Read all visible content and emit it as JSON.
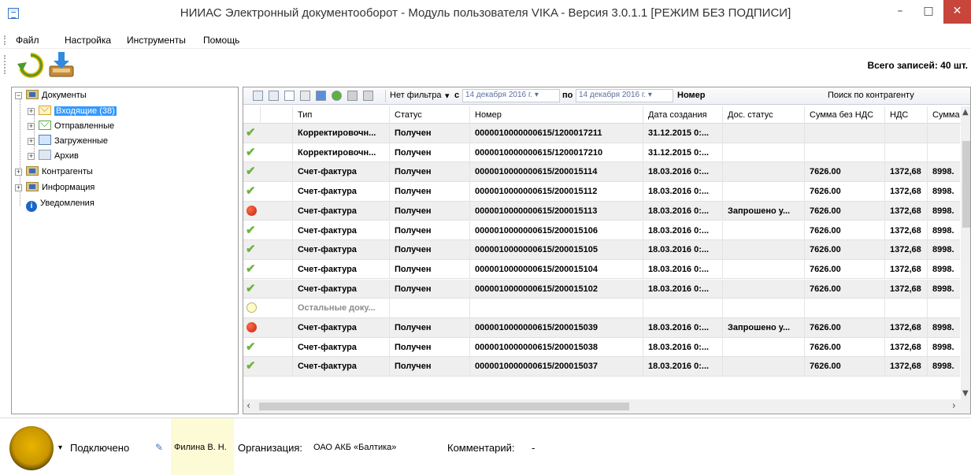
{
  "window": {
    "title": "НИИАС Электронный документооборот - Модуль пользователя VIKA - Версия 3.0.1.1 [РЕЖИМ БЕЗ ПОДПИСИ]",
    "minimize": "–",
    "maximize": "□",
    "close": "✕"
  },
  "menu": [
    "Файл",
    "Настройка",
    "Инструменты",
    "Помощь"
  ],
  "toolbar": {
    "total": "Всего записей: 40 шт."
  },
  "tree": {
    "documents": "Документы",
    "incoming": "Входящие (38)",
    "sent": "Отправленные",
    "uploaded": "Загруженные",
    "archive": "Архив",
    "contractors": "Контрагенты",
    "information": "Информация",
    "notifications": "Уведомления"
  },
  "grid_toolbar": {
    "filter": "Нет фильтра",
    "from_label": "с",
    "from_date": "14 декабря  2016 г.",
    "to_label": "по",
    "to_date": "14 декабря  2016 г.",
    "number_label": "Номер",
    "search_label": "Поиск по контрагенту"
  },
  "columns": [
    "Тип",
    "Статус",
    "Номер",
    "Дата создания",
    "Дос. статус",
    "Сумма без НДС",
    "НДС",
    "Сумма"
  ],
  "rows": [
    {
      "icon": "check",
      "type": "Корректировочн...",
      "status": "Получен",
      "number": "0000010000000615/1200017211",
      "date": "31.12.2015 0:...",
      "doc_status": "",
      "sum": "",
      "vat": "",
      "total": ""
    },
    {
      "icon": "check",
      "type": "Корректировочн...",
      "status": "Получен",
      "number": "0000010000000615/1200017210",
      "date": "31.12.2015 0:...",
      "doc_status": "",
      "sum": "",
      "vat": "",
      "total": ""
    },
    {
      "icon": "check",
      "type": "Счет-фактура",
      "status": "Получен",
      "number": "0000010000000615/200015114",
      "date": "18.03.2016 0:...",
      "doc_status": "",
      "sum": "7626.00",
      "vat": "1372,68",
      "total": "8998."
    },
    {
      "icon": "check",
      "type": "Счет-фактура",
      "status": "Получен",
      "number": "0000010000000615/200015112",
      "date": "18.03.2016 0:...",
      "doc_status": "",
      "sum": "7626.00",
      "vat": "1372,68",
      "total": "8998."
    },
    {
      "icon": "red",
      "type": "Счет-фактура",
      "status": "Получен",
      "number": "0000010000000615/200015113",
      "date": "18.03.2016 0:...",
      "doc_status": "Запрошено у...",
      "sum": "7626.00",
      "vat": "1372,68",
      "total": "8998."
    },
    {
      "icon": "check",
      "type": "Счет-фактура",
      "status": "Получен",
      "number": "0000010000000615/200015106",
      "date": "18.03.2016 0:...",
      "doc_status": "",
      "sum": "7626.00",
      "vat": "1372,68",
      "total": "8998."
    },
    {
      "icon": "check",
      "type": "Счет-фактура",
      "status": "Получен",
      "number": "0000010000000615/200015105",
      "date": "18.03.2016 0:...",
      "doc_status": "",
      "sum": "7626.00",
      "vat": "1372,68",
      "total": "8998."
    },
    {
      "icon": "check",
      "type": "Счет-фактура",
      "status": "Получен",
      "number": "0000010000000615/200015104",
      "date": "18.03.2016 0:...",
      "doc_status": "",
      "sum": "7626.00",
      "vat": "1372,68",
      "total": "8998."
    },
    {
      "icon": "check",
      "type": "Счет-фактура",
      "status": "Получен",
      "number": "0000010000000615/200015102",
      "date": "18.03.2016 0:...",
      "doc_status": "",
      "sum": "7626.00",
      "vat": "1372,68",
      "total": "8998."
    },
    {
      "icon": "yellow",
      "group": true,
      "type": "Остальные доку...",
      "status": "",
      "number": "",
      "date": "",
      "doc_status": "",
      "sum": "",
      "vat": "",
      "total": ""
    },
    {
      "icon": "red",
      "type": "Счет-фактура",
      "status": "Получен",
      "number": "0000010000000615/200015039",
      "date": "18.03.2016 0:...",
      "doc_status": "Запрошено у...",
      "sum": "7626.00",
      "vat": "1372,68",
      "total": "8998."
    },
    {
      "icon": "check",
      "type": "Счет-фактура",
      "status": "Получен",
      "number": "0000010000000615/200015038",
      "date": "18.03.2016 0:...",
      "doc_status": "",
      "sum": "7626.00",
      "vat": "1372,68",
      "total": "8998."
    },
    {
      "icon": "check",
      "type": "Счет-фактура",
      "status": "Получен",
      "number": "0000010000000615/200015037",
      "date": "18.03.2016 0:...",
      "doc_status": "",
      "sum": "7626.00",
      "vat": "1372,68",
      "total": "8998."
    }
  ],
  "statusbar": {
    "connected": "Подключено",
    "user": "Филина В. Н.",
    "org_label": "Организация:",
    "org": "ОАО АКБ «Балтика»",
    "comment_label": "Комментарий:",
    "comment": "-"
  },
  "colors": {
    "accent": "#3399ff",
    "check": "#6cb33f",
    "alert": "#c0260c",
    "close": "#c7453a"
  },
  "icons": [
    "refresh-icon",
    "download-icon",
    "check-icon",
    "red-dot-icon",
    "yellow-dot-icon",
    "info-icon"
  ]
}
